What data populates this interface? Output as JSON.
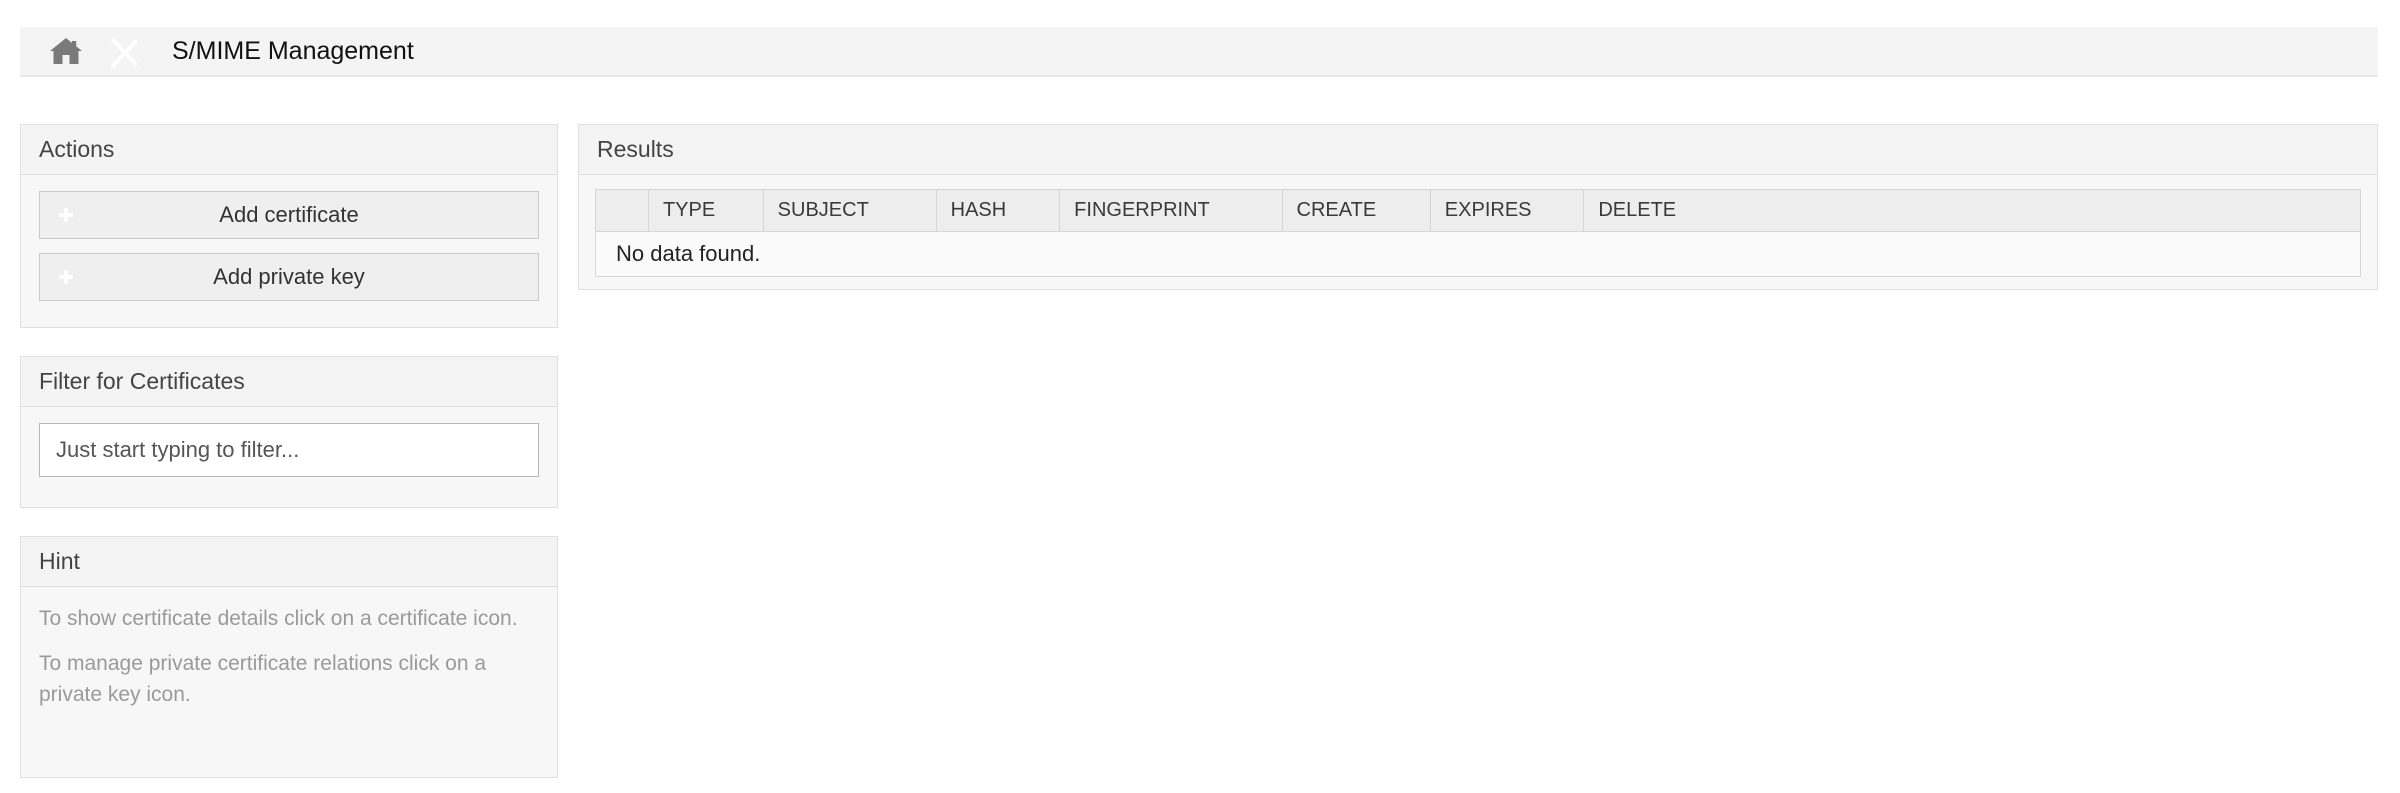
{
  "breadcrumb": {
    "home_icon": "home-icon",
    "separator_icon": "chevron-right-separator-icon",
    "title": "S/MIME Management"
  },
  "sidebar": {
    "actions": {
      "header": "Actions",
      "buttons": [
        {
          "label": "Add certificate",
          "icon": "plus-icon"
        },
        {
          "label": "Add private key",
          "icon": "plus-icon"
        }
      ]
    },
    "filter": {
      "header": "Filter for Certificates",
      "input_value": "",
      "input_placeholder": "Just start typing to filter..."
    },
    "hint": {
      "header": "Hint",
      "lines": [
        "To show certificate details click on a certificate icon.",
        "To manage private certificate relations click on a private key icon."
      ]
    }
  },
  "results": {
    "header": "Results",
    "columns": [
      "",
      "TYPE",
      "SUBJECT",
      "HASH",
      "FINGERPRINT",
      "CREATE",
      "EXPIRES",
      "DELETE"
    ],
    "column_widths": [
      "3.0%",
      "6.5%",
      "9.8%",
      "7.0%",
      "12.6%",
      "8.4%",
      "8.7%",
      "44.0%"
    ],
    "empty_message": "No data found.",
    "rows": []
  },
  "colors": {
    "page_background": "#ffffff",
    "bar_background": "#f4f4f4",
    "panel_background": "#f7f7f7",
    "panel_border": "#e0e0e0",
    "accent_green": "#39a845",
    "header_text": "#444444",
    "hint_text": "#9a9a9a",
    "table_header_background": "#ededed"
  }
}
